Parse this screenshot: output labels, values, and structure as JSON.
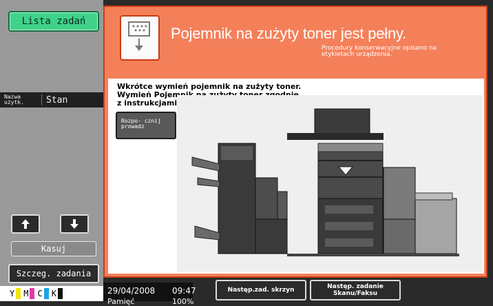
{
  "sidebar": {
    "job_list_label": "Lista zadań",
    "user_name_header": "Nazwa użytk.",
    "state_header": "Stan",
    "delete_label": "Kasuj",
    "job_details_label": "Szczeg. zadania",
    "toners": [
      {
        "letter": "Y",
        "color": "#f2e600"
      },
      {
        "letter": "M",
        "color": "#e03aa7"
      },
      {
        "letter": "C",
        "color": "#1aa6e8"
      },
      {
        "letter": "K",
        "color": "#111111"
      }
    ]
  },
  "alert": {
    "title": "Pojemnik na zużyty toner jest pełny.",
    "subtitle": "Procedury konserwacyjne opisano na etykietach urządzenia.",
    "instructions_line1": "Wkrótce wymień pojemnik na zużyty toner.",
    "instructions_line2": "Wymień Pojemnik na zużyty toner zgodnie",
    "instructions_line3": "z instrukcjami.",
    "start_guide_label": "Rozpo- cznij prowadz"
  },
  "status_bar": {
    "date": "29/04/2008",
    "time": "09:47",
    "memory_label": "Pamięć",
    "memory_value": "100%"
  },
  "bottom_buttons": {
    "next_job_box": "Następ.zad. skrzyn",
    "next_job_scan_fax": "Następ. zadanie Skanu/Faksu"
  }
}
